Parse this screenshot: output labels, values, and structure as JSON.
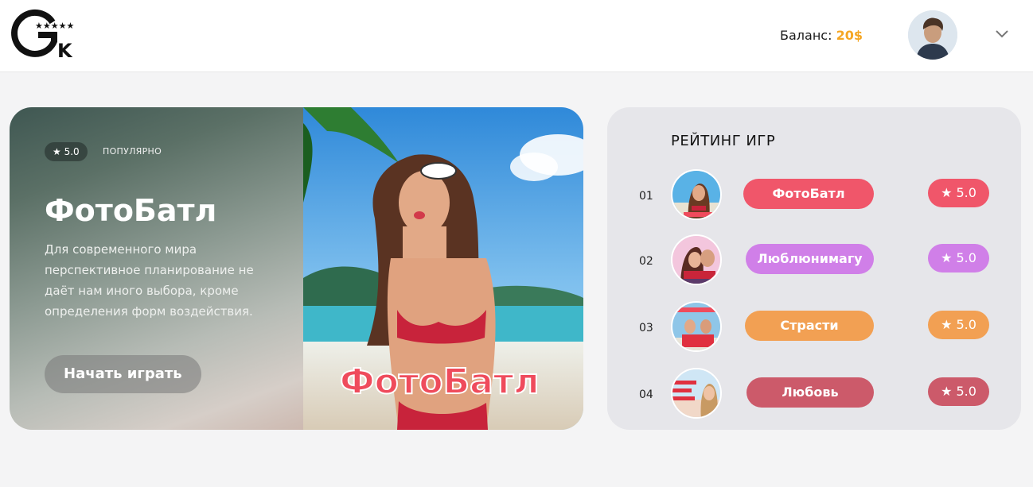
{
  "header": {
    "logo_text": "GK",
    "balance_label": "Баланс:",
    "balance_value": "20$",
    "icons": {
      "logo": "gk-stars-logo",
      "avatar": "user-avatar",
      "chevron": "chevron-down-icon"
    }
  },
  "hero": {
    "rating_badge": "★ 5.0",
    "tag": "ПОПУЛЯРНО",
    "title": "ФотоБатл",
    "description": "Для современного мира перспективное планирование не даёт нам иного выбора, кроме определения форм воздействия.",
    "play_button": "Начать играть",
    "image_logo_text": "ФотоБатл"
  },
  "rating": {
    "title": "РЕЙТИНГ ИГР",
    "items": [
      {
        "num": "01",
        "name": "ФотоБатл",
        "score": "★ 5.0",
        "color": "#f0566a"
      },
      {
        "num": "02",
        "name": "Люблюнимагу",
        "score": "★ 5.0",
        "color": "#d07fe8"
      },
      {
        "num": "03",
        "name": "Страсти",
        "score": "★ 5.0",
        "color": "#f2a053"
      },
      {
        "num": "04",
        "name": "Любовь",
        "score": "★ 5.0",
        "color": "#cc5a6a"
      }
    ]
  },
  "colors": {
    "accent_balance": "#f5a623"
  }
}
